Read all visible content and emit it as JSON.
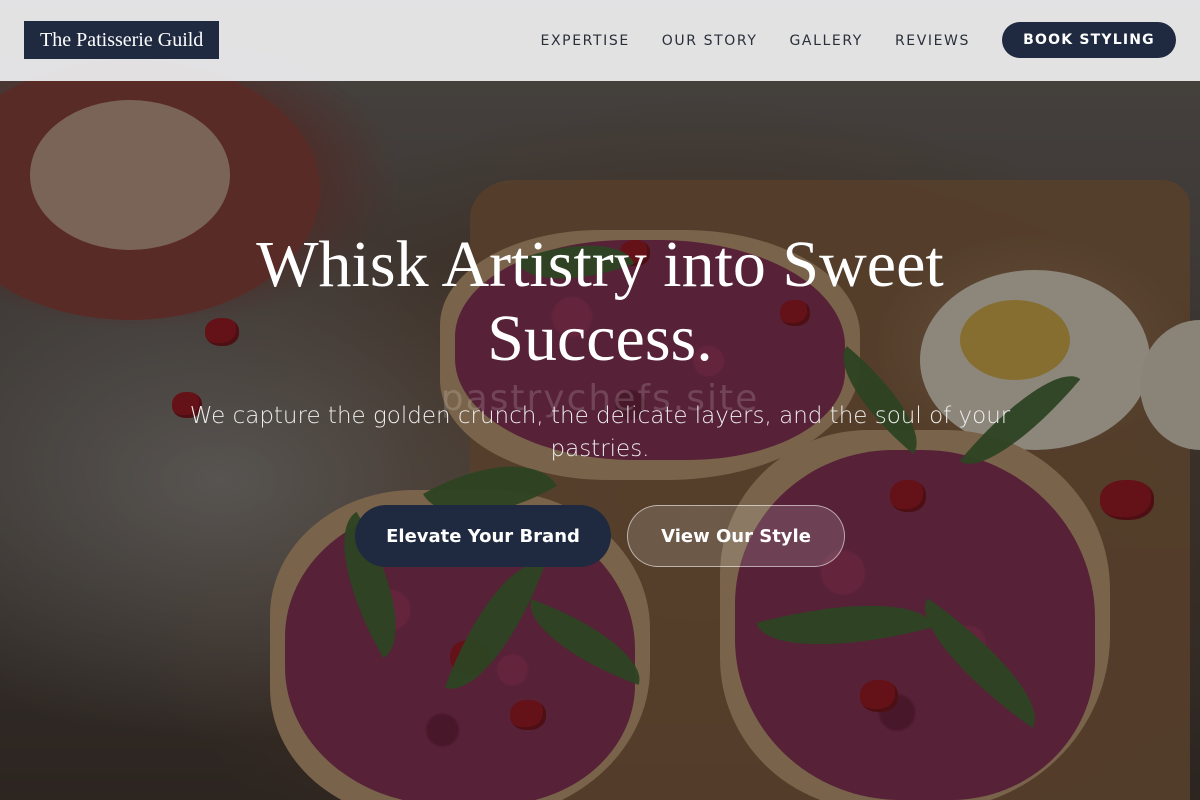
{
  "header": {
    "logo_text": "The Patisserie Guild",
    "nav": [
      {
        "label": "EXPERTISE"
      },
      {
        "label": "OUR STORY"
      },
      {
        "label": "GALLERY"
      },
      {
        "label": "REVIEWS"
      }
    ],
    "cta_label": "BOOK STYLING"
  },
  "hero": {
    "title": "Whisk Artistry into Sweet Success.",
    "watermark": "pastrychefs.site",
    "subtitle": "We capture the golden crunch, the delicate layers, and the soul of your pastries.",
    "primary_button": "Elevate Your Brand",
    "secondary_button": "View Our Style"
  },
  "colors": {
    "brand_navy": "#1f2a40",
    "header_bg": "#ececee",
    "text_light": "#ffffff"
  }
}
